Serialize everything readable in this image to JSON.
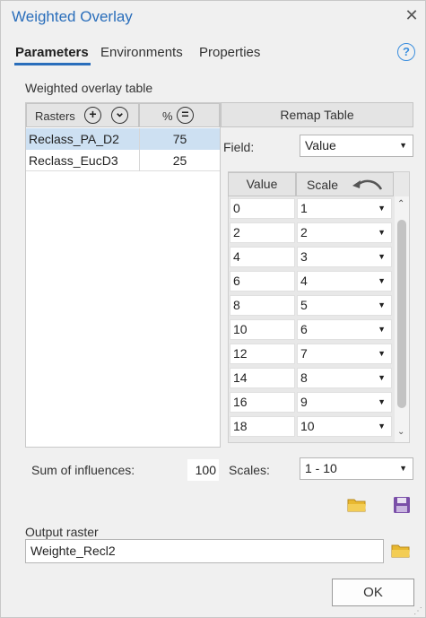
{
  "window": {
    "title": "Weighted Overlay",
    "close_symbol": "✕"
  },
  "tabs": [
    {
      "label": "Parameters",
      "active": true
    },
    {
      "label": "Environments",
      "active": false
    },
    {
      "label": "Properties",
      "active": false
    }
  ],
  "help_symbol": "?",
  "weighted_table": {
    "label": "Weighted overlay table",
    "rasters_header": "Rasters",
    "percent_header": "%",
    "add_symbol": "+",
    "options_symbol": "⌄",
    "equal_symbol": "=",
    "rows": [
      {
        "raster": "Reclass_PA_D2",
        "percent": "75",
        "selected": true
      },
      {
        "raster": "Reclass_EucD3",
        "percent": "25",
        "selected": false
      }
    ]
  },
  "remap": {
    "header": "Remap Table",
    "field_label": "Field:",
    "field_value": "Value",
    "value_header": "Value",
    "scale_header": "Scale",
    "rows": [
      {
        "value": "0",
        "scale": "1"
      },
      {
        "value": "2",
        "scale": "2"
      },
      {
        "value": "4",
        "scale": "3"
      },
      {
        "value": "6",
        "scale": "4"
      },
      {
        "value": "8",
        "scale": "5"
      },
      {
        "value": "10",
        "scale": "6"
      },
      {
        "value": "12",
        "scale": "7"
      },
      {
        "value": "14",
        "scale": "8"
      },
      {
        "value": "16",
        "scale": "9"
      },
      {
        "value": "18",
        "scale": "10"
      }
    ]
  },
  "sum": {
    "label": "Sum of influences:",
    "value": "100"
  },
  "scales": {
    "label": "Scales:",
    "value": "1 - 10"
  },
  "output": {
    "label": "Output raster",
    "value": "Weighte_Recl2"
  },
  "ok_label": "OK",
  "colors": {
    "accent": "#2a6ebb",
    "selection": "#cde0f2",
    "folder": "#e8b830",
    "save": "#7a4fa8"
  }
}
